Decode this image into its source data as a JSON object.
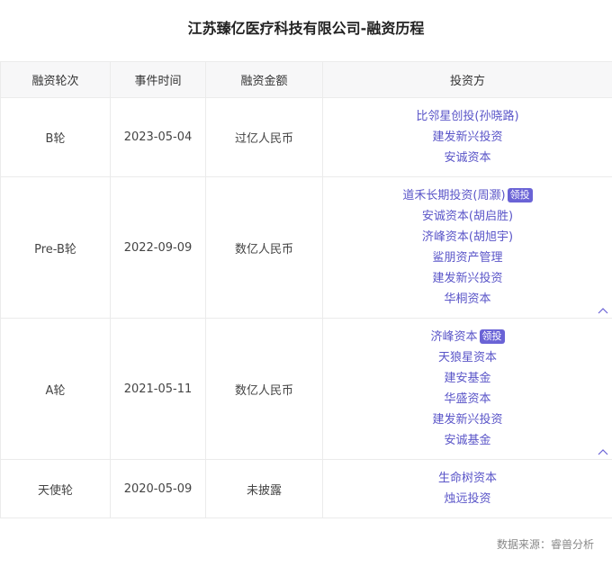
{
  "title": "江苏臻亿医疗科技有限公司-融资历程",
  "headers": [
    "融资轮次",
    "事件时间",
    "融资金额",
    "投资方"
  ],
  "rows": [
    {
      "round": "B轮",
      "date": "2023-05-04",
      "amount": "过亿人民币",
      "investors": [
        {
          "name": "比邻星创投(孙晓路)"
        },
        {
          "name": "建发新兴投资"
        },
        {
          "name": "安诚资本"
        }
      ]
    },
    {
      "round": "Pre-B轮",
      "date": "2022-09-09",
      "amount": "数亿人民币",
      "investors": [
        {
          "name": "道禾长期投资(周灏)",
          "badge": "领投"
        },
        {
          "name": "安诚资本(胡启胜)"
        },
        {
          "name": "济峰资本(胡旭宇)"
        },
        {
          "name": "鲨朋资产管理"
        },
        {
          "name": "建发新兴投资"
        },
        {
          "name": "华桐资本"
        }
      ]
    },
    {
      "round": "A轮",
      "date": "2021-05-11",
      "amount": "数亿人民币",
      "investors": [
        {
          "name": "济峰资本",
          "badge": "领投"
        },
        {
          "name": "天狼星资本"
        },
        {
          "name": "建安基金"
        },
        {
          "name": "华盛资本"
        },
        {
          "name": "建发新兴投资"
        },
        {
          "name": "安诚基金"
        }
      ]
    },
    {
      "round": "天使轮",
      "date": "2020-05-09",
      "amount": "未披露",
      "investors": [
        {
          "name": "生命树资本"
        },
        {
          "name": "烛远投资"
        }
      ]
    }
  ],
  "source": "数据来源：睿兽分析"
}
